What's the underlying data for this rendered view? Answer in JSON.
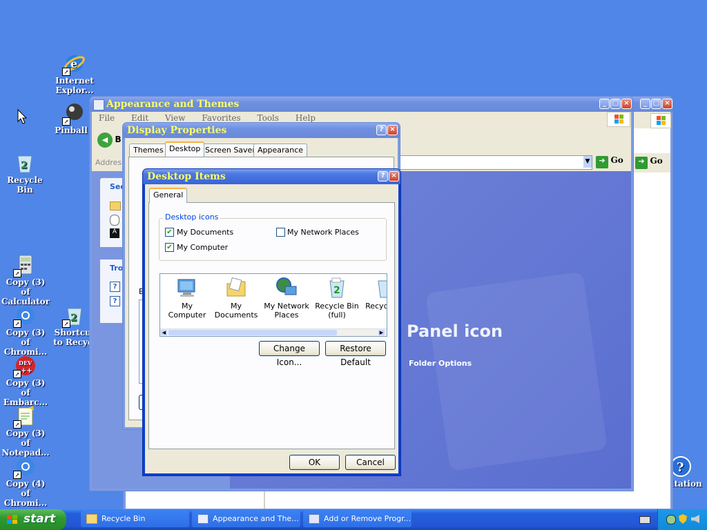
{
  "desktop": {
    "icons": [
      {
        "label": "Internet Explor..."
      },
      {
        "label": "Pinball ("
      },
      {
        "label": "Recycle Bin"
      },
      {
        "label": "Copy (3) of Calculator"
      },
      {
        "label": "Copy (3) of Chromi..."
      },
      {
        "label": "Shortcut to Recycl"
      },
      {
        "label": "Copy (3) of Embarc..."
      },
      {
        "label": "Copy (3) of Notepad..."
      },
      {
        "label": "Copy (4) of Chromi..."
      },
      {
        "label": "itation"
      }
    ]
  },
  "back_window": {
    "go_label": "Go"
  },
  "appearance_window": {
    "title": "Appearance and Themes",
    "menu": [
      "File",
      "Edit",
      "View",
      "Favorites",
      "Tools",
      "Help"
    ],
    "back_label": "B",
    "address_label": "Address",
    "go_label": "Go",
    "see_also_label": "See",
    "troubleshoot_label": "Tro",
    "panel_icon_text": "Panel icon",
    "folder_options_label": "Folder Options"
  },
  "display_properties": {
    "title": "Display Properties",
    "tabs": [
      "Themes",
      "Desktop",
      "Screen Saver",
      "Appearance"
    ],
    "selected_tab": "Desktop",
    "background_label": "B"
  },
  "desktop_items": {
    "title": "Desktop Items",
    "tab": "General",
    "group_label": "Desktop icons",
    "checkboxes": [
      {
        "label": "My Documents",
        "checked": true
      },
      {
        "label": "My Network Places",
        "checked": false
      },
      {
        "label": "My Computer",
        "checked": true
      }
    ],
    "icons": [
      {
        "label": "My Computer"
      },
      {
        "label": "My Documents"
      },
      {
        "label": "My Network Places"
      },
      {
        "label": "Recycle Bin (full)"
      },
      {
        "label": "Recyc (em"
      }
    ],
    "change_icon_label": "Change Icon...",
    "restore_default_label": "Restore Default",
    "ok_label": "OK",
    "cancel_label": "Cancel"
  },
  "taskbar": {
    "start_label": "start",
    "items": [
      {
        "label": "Recycle Bin"
      },
      {
        "label": "Appearance and The..."
      },
      {
        "label": "Add or Remove Progr..."
      }
    ]
  }
}
